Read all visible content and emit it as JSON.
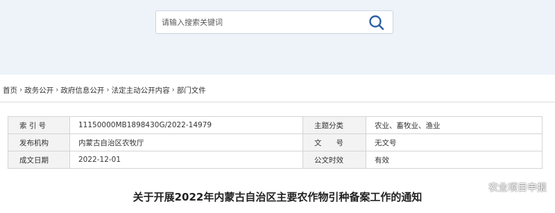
{
  "search": {
    "placeholder": "请输入搜索关键词",
    "icon": "search-icon",
    "accent": "#2b5fa5"
  },
  "breadcrumb": {
    "items": [
      "首页",
      "政务公开",
      "政府信息公开",
      "法定主动公开内容",
      "部门文件"
    ],
    "separator": "›"
  },
  "meta": {
    "rows": [
      {
        "label1": "索 引 号",
        "value1": "11150000MB1898430G/2022-14979",
        "label2": "主题分类",
        "value2": "农业、畜牧业、渔业"
      },
      {
        "label1": "发布机构",
        "value1": "内蒙古自治区农牧厅",
        "label2": "文　　号",
        "value2": "无文号"
      },
      {
        "label1": "成文日期",
        "value1": "2022-12-01",
        "label2": "公文时效",
        "value2": "有效"
      }
    ]
  },
  "article": {
    "title": "关于开展2022年内蒙古自治区主要农作物引种备案工作的通知"
  },
  "watermark": {
    "text": "农业项目申报",
    "icon": "wechat-icon"
  }
}
